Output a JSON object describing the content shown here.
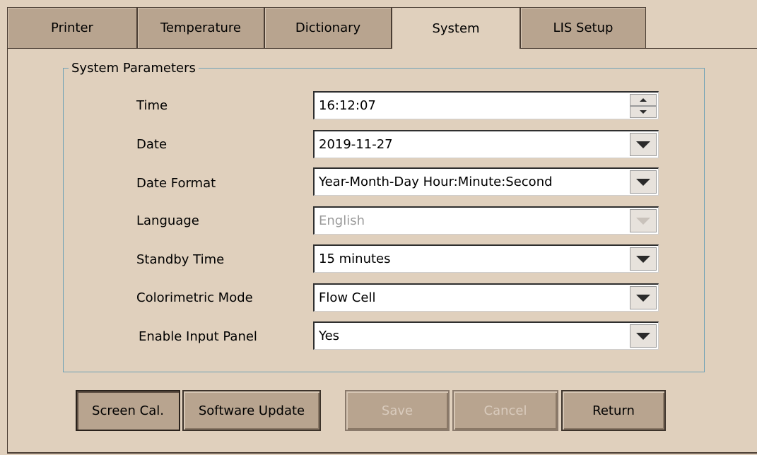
{
  "tabs": [
    {
      "label": "Printer",
      "active": false
    },
    {
      "label": "Temperature",
      "active": false
    },
    {
      "label": "Dictionary",
      "active": false
    },
    {
      "label": "System",
      "active": true
    },
    {
      "label": "LIS Setup",
      "active": false
    }
  ],
  "group_title": "System Parameters",
  "fields": {
    "time": {
      "label": "Time",
      "value": "16:12:07",
      "control": "spinner"
    },
    "date": {
      "label": "Date",
      "value": "2019-11-27",
      "control": "dropdown"
    },
    "date_format": {
      "label": "Date Format",
      "value": "Year-Month-Day Hour:Minute:Second",
      "control": "dropdown"
    },
    "language": {
      "label": "Language",
      "value": "English",
      "control": "dropdown",
      "disabled": true
    },
    "standby_time": {
      "label": "Standby Time",
      "value": "15 minutes",
      "control": "dropdown"
    },
    "colorimetric_mode": {
      "label": "Colorimetric Mode",
      "value": "Flow Cell",
      "control": "dropdown"
    },
    "enable_input_panel": {
      "label": "Enable Input Panel",
      "value": "Yes",
      "control": "dropdown"
    }
  },
  "buttons": {
    "screen_cal": "Screen Cal.",
    "software_update": "Software Update",
    "save": "Save",
    "cancel": "Cancel",
    "return": "Return"
  },
  "colors": {
    "background": "#e0d0bd",
    "tab_inactive": "#b8a48f",
    "group_border": "#6ea1b5",
    "disabled_text": "#9a9a9a"
  },
  "icons": {
    "dropdown": "chevron-down-icon",
    "spin_up": "arrow-up-icon",
    "spin_down": "arrow-down-icon"
  }
}
